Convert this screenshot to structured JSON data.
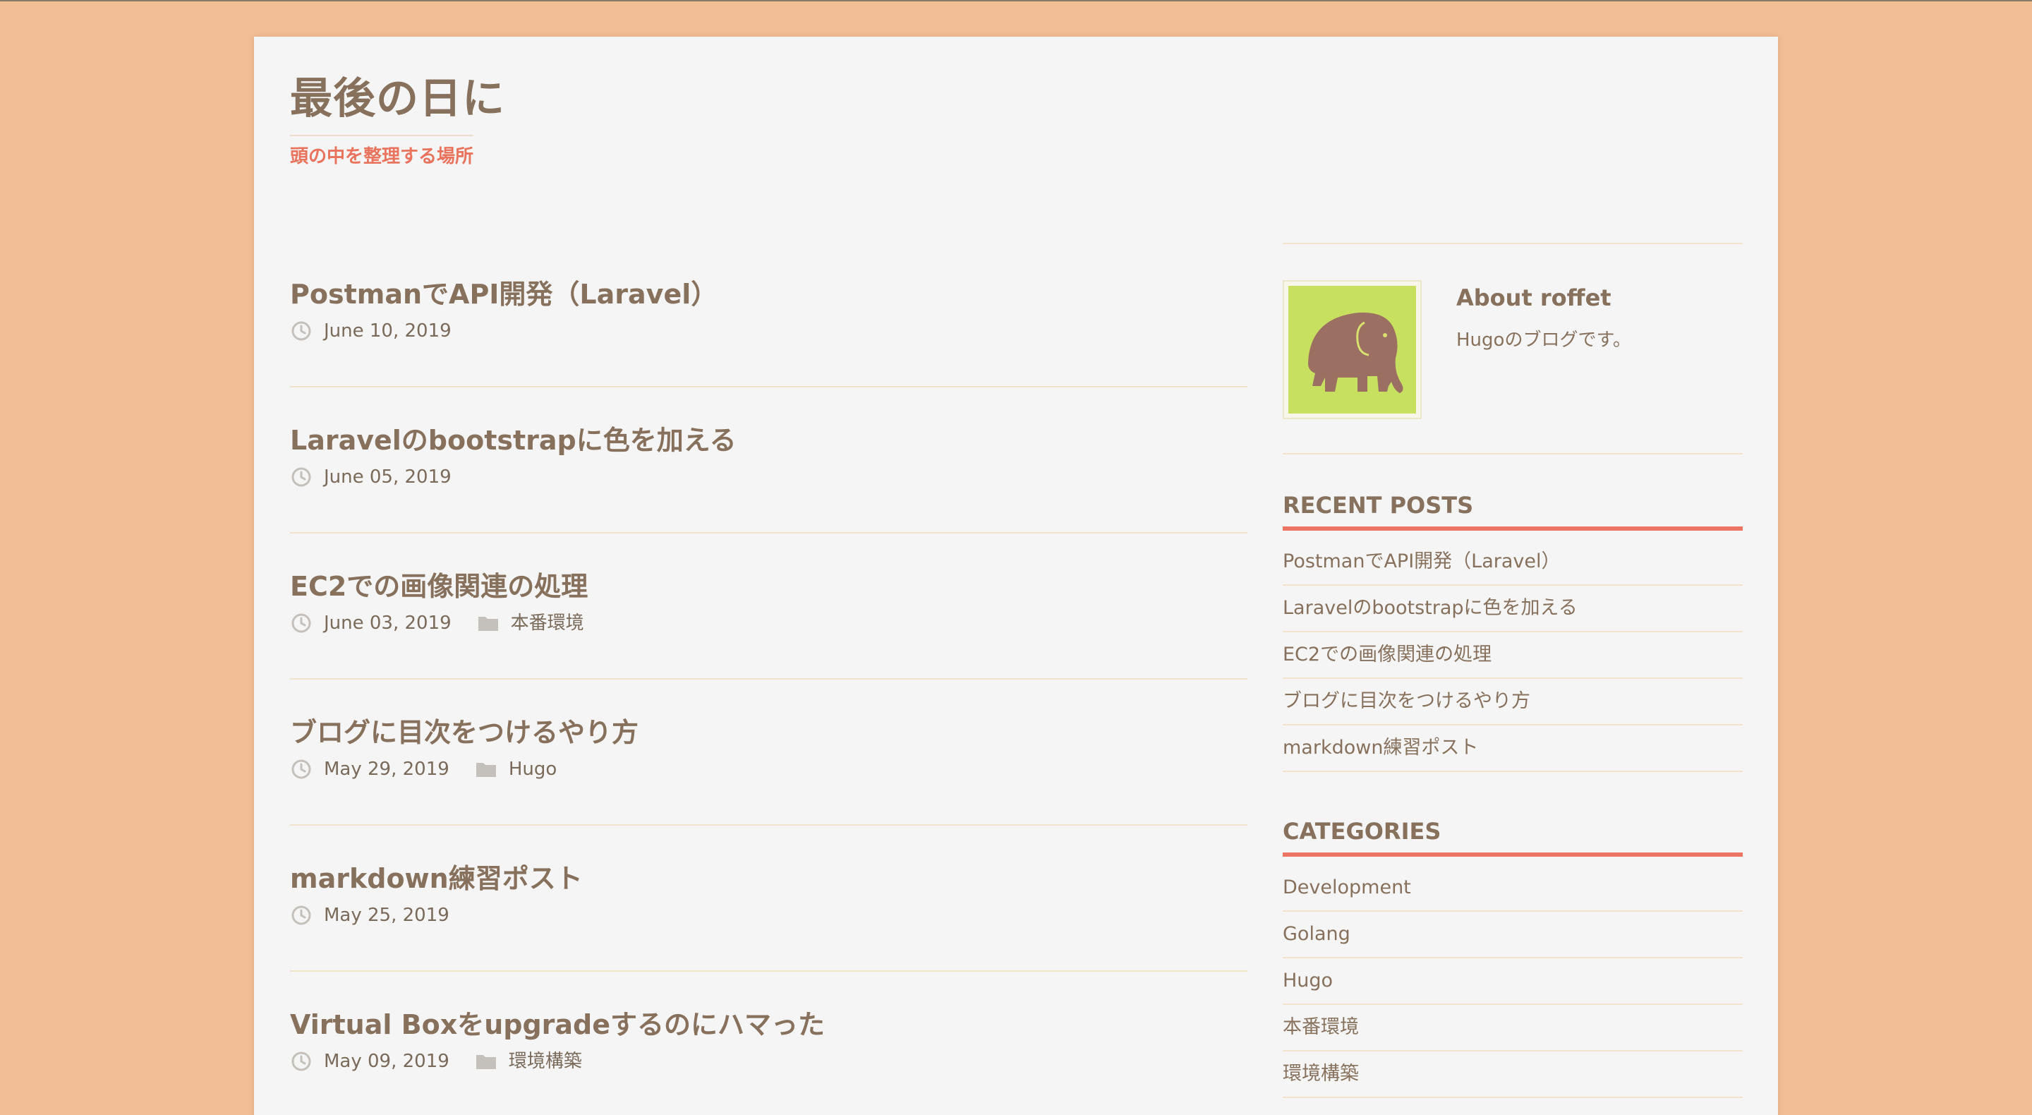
{
  "site": {
    "title": "最後の日に",
    "description": "頭の中を整理する場所"
  },
  "posts": [
    {
      "title": "PostmanでAPI開発（Laravel）",
      "date": "June 10, 2019",
      "category": ""
    },
    {
      "title": "Laravelのbootstrapに色を加える",
      "date": "June 05, 2019",
      "category": ""
    },
    {
      "title": "EC2での画像関連の処理",
      "date": "June 03, 2019",
      "category": "本番環境"
    },
    {
      "title": "ブログに目次をつけるやり方",
      "date": "May 29, 2019",
      "category": "Hugo"
    },
    {
      "title": "markdown練習ポスト",
      "date": "May 25, 2019",
      "category": ""
    },
    {
      "title": "Virtual Boxをupgradeするのにハマった",
      "date": "May 09, 2019",
      "category": "環境構築"
    }
  ],
  "sidebar": {
    "about": {
      "title": "About roffet",
      "body": "Hugoのブログです。"
    },
    "recent_posts": {
      "title": "RECENT POSTS",
      "items": [
        "PostmanでAPI開発（Laravel）",
        "Laravelのbootstrapに色を加える",
        "EC2での画像関連の処理",
        "ブログに目次をつけるやり方",
        "markdown練習ポスト"
      ]
    },
    "categories": {
      "title": "CATEGORIES",
      "items": [
        "Development",
        "Golang",
        "Hugo",
        "本番環境",
        "環境構築"
      ]
    }
  },
  "colors": {
    "background": "#f2be96",
    "accent": "#ec7462",
    "text": "#87715c",
    "avatar_bg": "#c8e060",
    "elephant": "#9b6f62"
  },
  "icons": {
    "date": "clock-icon",
    "category": "folder-icon",
    "avatar": "elephant-icon"
  }
}
